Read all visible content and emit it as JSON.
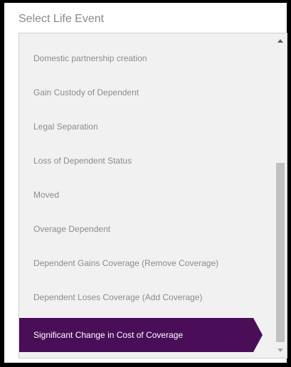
{
  "header": {
    "title": "Select Life Event"
  },
  "life_events": {
    "items": [
      "Domestic partnership creation",
      "Gain Custody of Dependent",
      "Legal Separation",
      "Loss of Dependent Status",
      "Moved",
      "Overage Dependent",
      "Dependent Gains Coverage (Remove Coverage)",
      "Dependent Loses Coverage (Add Coverage)",
      "Significant Change in Cost of Coverage"
    ],
    "selected": "Significant Change in Cost of Coverage"
  },
  "colors": {
    "selected_background": "#4a0e59",
    "selected_text": "#ffffff",
    "item_text": "#8c8c8c",
    "list_background": "#f1f1f1"
  },
  "icons": {
    "scroll_up": "scroll-up-arrow-icon",
    "scroll_down": "scroll-down-arrow-icon"
  }
}
